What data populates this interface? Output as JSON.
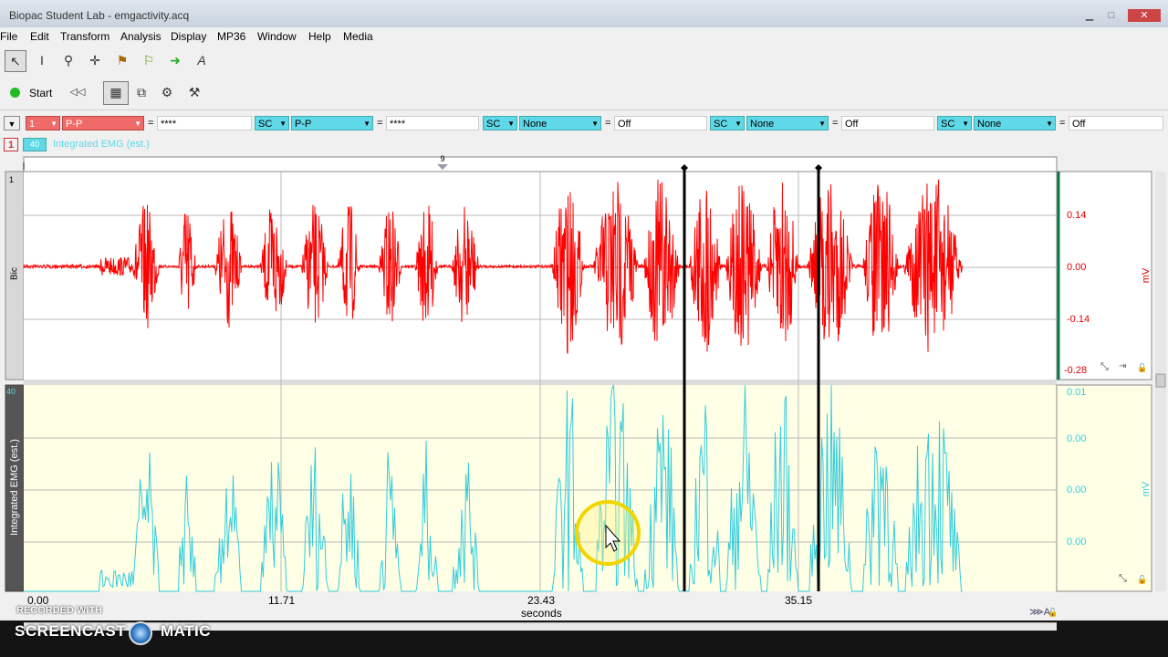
{
  "window": {
    "title": "Biopac Student Lab - emgactivity.acq"
  },
  "menu": [
    "File",
    "Edit",
    "Transform",
    "Analysis",
    "Display",
    "MP36",
    "Window",
    "Help",
    "Media"
  ],
  "toolbar": {
    "start_label": "Start"
  },
  "measurements": [
    {
      "channel": "1",
      "type": "P-P",
      "value": "****"
    },
    {
      "channel": "SC",
      "type": "P-P",
      "value": "****"
    },
    {
      "channel": "SC",
      "type": "None",
      "value": "Off"
    },
    {
      "channel": "SC",
      "type": "None",
      "value": "Off"
    },
    {
      "channel": "SC",
      "type": "None",
      "value": "Off"
    }
  ],
  "channels": {
    "active_number": "1",
    "active_label": "Integrated EMG (est.)",
    "ch1": {
      "label": "Bic",
      "number": "1",
      "unit": "mV",
      "ticks": [
        "0.14",
        "0.00",
        "-0.14",
        "-0.28"
      ],
      "color": "#ff0000"
    },
    "ch40": {
      "label": "Integrated EMG (est.)",
      "number": "40",
      "unit": "mV",
      "ticks": [
        "0.01",
        "0.00",
        "0.00",
        "0.00"
      ],
      "color": "#33ccdd"
    }
  },
  "xaxis": {
    "ticks": [
      "0.00",
      "11.71",
      "23.43",
      "35.15"
    ],
    "unit": "seconds"
  },
  "marker": {
    "label": "9"
  },
  "watermark": {
    "line1": "RECORDED WITH",
    "line2": "SCREENCAST",
    "line3": "MATIC"
  },
  "colors": {
    "emg_raw": "#ff0000",
    "emg_integrated": "#33ccdd",
    "lower_bg": "#ffffe6"
  }
}
